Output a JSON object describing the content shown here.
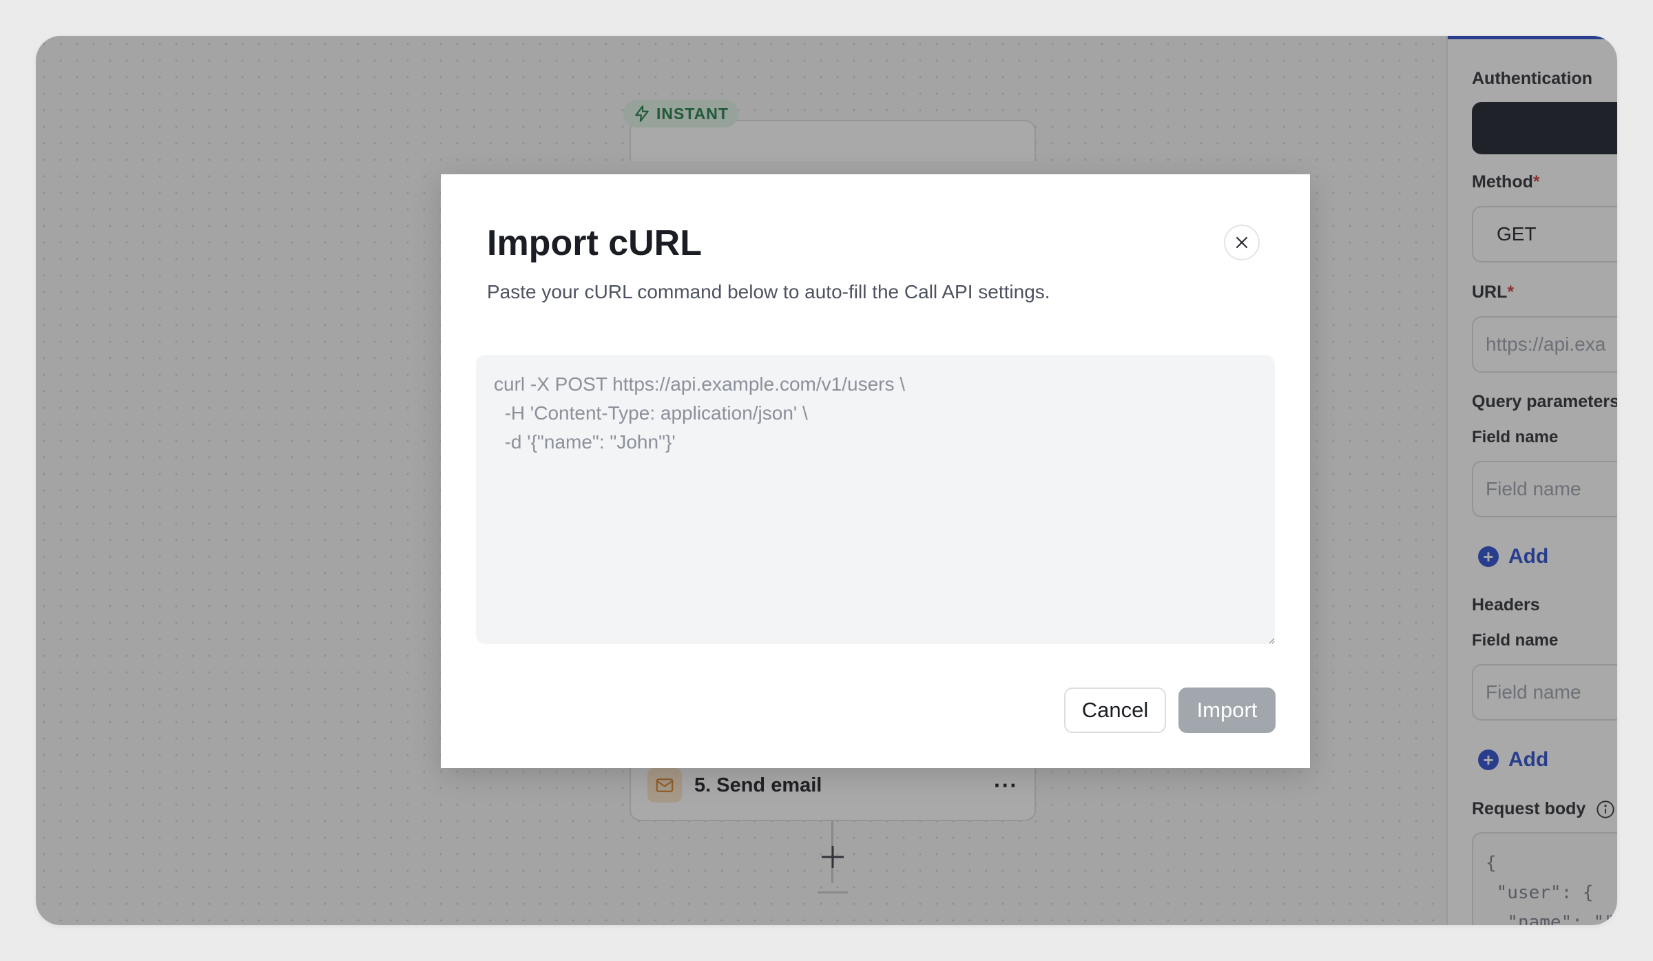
{
  "canvas": {
    "trigger_badge": "INSTANT",
    "node_email": {
      "label": "5. Send email",
      "more": "···"
    }
  },
  "side_panel": {
    "authentication_label": "Authentication",
    "method_label": "Method",
    "method_value": "GET",
    "url_label": "URL",
    "url_placeholder": "https://api.exa",
    "required_mark": "*",
    "query_params_label": "Query parameters",
    "query_field_name_label": "Field name",
    "query_field_placeholder": "Field name",
    "query_add_label": "Add",
    "headers_label": "Headers",
    "headers_field_name_label": "Field name",
    "headers_field_placeholder": "Field name",
    "headers_add_label": "Add",
    "request_body_label": "Request body",
    "request_body_code": "{\n \"user\": {\n  \"name\": \"\""
  },
  "modal": {
    "title": "Import cURL",
    "description": "Paste your cURL command below to auto-fill the Call API settings.",
    "input_placeholder": "curl -X POST https://api.example.com/v1/users \\\n  -H 'Content-Type: application/json' \\\n  -d '{\"name\": \"John\"}'",
    "cancel_label": "Cancel",
    "import_label": "Import"
  },
  "colors": {
    "accent": "#2a4bd0",
    "instant_badge_bg": "#dff3e6",
    "instant_badge_text": "#1e7b45",
    "import_disabled": "#a2a6ad",
    "email_icon_bg": "#fde7c9"
  }
}
